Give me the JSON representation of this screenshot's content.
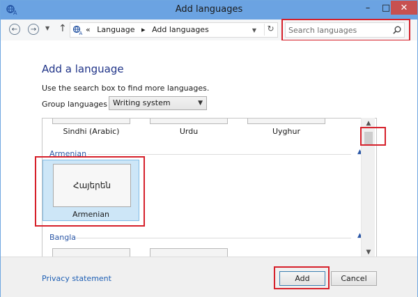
{
  "window": {
    "title": "Add languages",
    "minimize": "–",
    "maximize": "□",
    "close": "✕"
  },
  "addressbar": {
    "crumb_sep": "«",
    "crumbs": [
      "Language",
      "Add languages"
    ],
    "crumb_arrow": "▸",
    "search_placeholder": "Search languages"
  },
  "content": {
    "heading": "Add a language",
    "instruction": "Use the search box to find more languages.",
    "group_by_label": "Group languages by:",
    "group_by_value": "Writing system"
  },
  "list": {
    "top_row": [
      "Sindhi (Arabic)",
      "Urdu",
      "Uyghur"
    ],
    "groups": [
      {
        "name": "Armenian",
        "tiles": [
          {
            "native": "Հայերեն",
            "name": "Armenian",
            "selected": true
          }
        ]
      },
      {
        "name": "Bangla",
        "tiles": []
      }
    ]
  },
  "footer": {
    "privacy": "Privacy statement",
    "add": "Add",
    "cancel": "Cancel"
  },
  "colors": {
    "titlebar": "#6ba3e2",
    "heading": "#1e3287",
    "highlight": "#d6202a",
    "selected_tile": "#cde6f7",
    "link": "#1e5fb4"
  }
}
